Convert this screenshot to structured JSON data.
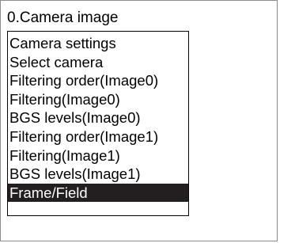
{
  "window": {
    "title": "0.Camera image"
  },
  "menu": {
    "items": [
      {
        "label": "Camera settings"
      },
      {
        "label": "Select camera"
      },
      {
        "label": "Filtering order(Image0)"
      },
      {
        "label": "Filtering(Image0)"
      },
      {
        "label": "BGS levels(Image0)"
      },
      {
        "label": "Filtering order(Image1)"
      },
      {
        "label": "Filtering(Image1)"
      },
      {
        "label": "BGS levels(Image1)"
      },
      {
        "label": "Frame/Field"
      }
    ],
    "selected_item": "Frame/Field"
  },
  "colors": {
    "selection_background": "#231f20",
    "selection_text": "#ffffff",
    "border": "#000000"
  }
}
